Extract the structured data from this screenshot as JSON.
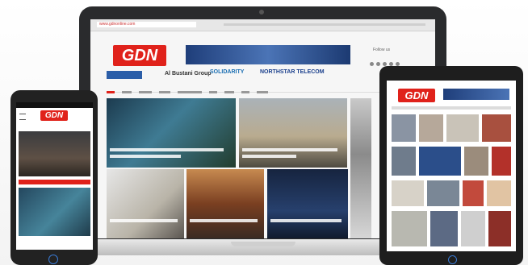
{
  "brand": {
    "logo_text": "GDN"
  },
  "laptop": {
    "url": "www.gdnonline.com",
    "sponsors": [
      "Al Bustani Group",
      "SOLIDARITY",
      "NORTHSTAR TELECOM"
    ],
    "follow_label": "Follow us"
  },
  "colors": {
    "brand_red": "#e0221b",
    "nav_blue": "#2b5ea8",
    "device_black": "#2a2b2d",
    "home_button_blue": "#3a7bd5"
  },
  "icons": [
    "menu-icon",
    "home-button-icon",
    "camera-icon"
  ]
}
